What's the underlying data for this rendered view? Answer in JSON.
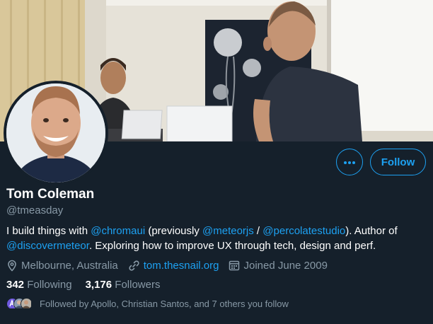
{
  "profile": {
    "name": "Tom Coleman",
    "handle": "@tmeasday",
    "bio": {
      "t1": "I build things with ",
      "m1": "@chromaui",
      "t2": " (previously ",
      "m2": "@meteorjs",
      "t3": " / ",
      "m3": "@percolatestudio",
      "t4": "). Author of ",
      "m4": "@discovermeteor",
      "t5": ". Exploring how to improve UX through tech, design and perf."
    },
    "location": "Melbourne, Australia",
    "website": "tom.thesnail.org",
    "joined": "Joined June 2009"
  },
  "stats": {
    "following_count": "342",
    "following_label": "Following",
    "followers_count": "3,176",
    "followers_label": "Followers"
  },
  "followed_by": "Followed by Apollo, Christian Santos, and 7 others you follow",
  "actions": {
    "follow_label": "Follow",
    "more_icon": "ellipsis-icon"
  },
  "icons": {
    "location": "map-pin-icon",
    "link": "link-icon",
    "calendar": "calendar-icon"
  },
  "colors": {
    "background": "#15202b",
    "accent": "#1da1f2",
    "secondary_text": "#8899a6",
    "primary_text": "#ffffff"
  }
}
